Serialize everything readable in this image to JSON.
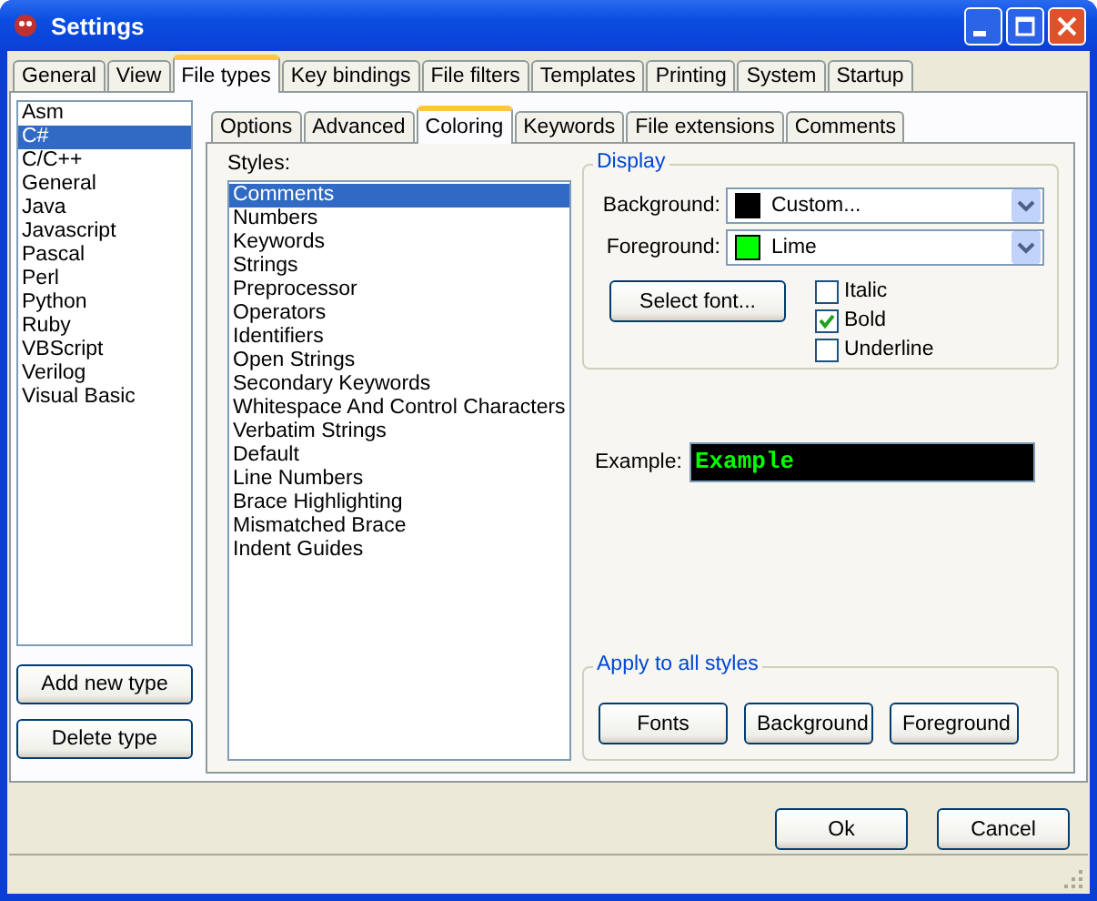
{
  "window": {
    "title": "Settings"
  },
  "tabs": [
    {
      "label": "General",
      "selected": false
    },
    {
      "label": "View",
      "selected": false
    },
    {
      "label": "File types",
      "selected": true
    },
    {
      "label": "Key bindings",
      "selected": false
    },
    {
      "label": "File filters",
      "selected": false
    },
    {
      "label": "Templates",
      "selected": false
    },
    {
      "label": "Printing",
      "selected": false
    },
    {
      "label": "System",
      "selected": false
    },
    {
      "label": "Startup",
      "selected": false
    }
  ],
  "file_types": {
    "items": [
      {
        "label": "Asm",
        "selected": false
      },
      {
        "label": "C#",
        "selected": true
      },
      {
        "label": "C/C++",
        "selected": false
      },
      {
        "label": "General",
        "selected": false
      },
      {
        "label": "Java",
        "selected": false
      },
      {
        "label": "Javascript",
        "selected": false
      },
      {
        "label": "Pascal",
        "selected": false
      },
      {
        "label": "Perl",
        "selected": false
      },
      {
        "label": "Python",
        "selected": false
      },
      {
        "label": "Ruby",
        "selected": false
      },
      {
        "label": "VBScript",
        "selected": false
      },
      {
        "label": "Verilog",
        "selected": false
      },
      {
        "label": "Visual Basic",
        "selected": false
      }
    ],
    "buttons": [
      "Add new type",
      "Delete type"
    ]
  },
  "sub_tabs": [
    {
      "label": "Options",
      "selected": false
    },
    {
      "label": "Advanced",
      "selected": false
    },
    {
      "label": "Coloring",
      "selected": true
    },
    {
      "label": "Keywords",
      "selected": false
    },
    {
      "label": "File extensions",
      "selected": false
    },
    {
      "label": "Comments",
      "selected": false
    }
  ],
  "styles": {
    "label": "Styles:",
    "items": [
      {
        "label": "Comments",
        "selected": true
      },
      {
        "label": "Numbers",
        "selected": false
      },
      {
        "label": "Keywords",
        "selected": false
      },
      {
        "label": "Strings",
        "selected": false
      },
      {
        "label": "Preprocessor",
        "selected": false
      },
      {
        "label": "Operators",
        "selected": false
      },
      {
        "label": "Identifiers",
        "selected": false
      },
      {
        "label": "Open Strings",
        "selected": false
      },
      {
        "label": "Secondary Keywords",
        "selected": false
      },
      {
        "label": "Whitespace And Control Characters",
        "selected": false
      },
      {
        "label": "Verbatim Strings",
        "selected": false
      },
      {
        "label": "Default",
        "selected": false
      },
      {
        "label": "Line Numbers",
        "selected": false
      },
      {
        "label": "Brace Highlighting",
        "selected": false
      },
      {
        "label": "Mismatched Brace",
        "selected": false
      },
      {
        "label": "Indent Guides",
        "selected": false
      }
    ]
  },
  "display": {
    "title": "Display",
    "colors": [
      {
        "label": "Background:",
        "value": "Custom...",
        "color": "#000000"
      },
      {
        "label": "Foreground:",
        "value": "Lime",
        "color": "#00ff00"
      }
    ],
    "select_font": "Select font...",
    "options": [
      {
        "label": "Italic",
        "checked": false
      },
      {
        "label": "Bold",
        "checked": true
      },
      {
        "label": "Underline",
        "checked": false
      }
    ]
  },
  "example": {
    "label": "Example:",
    "text": "Example"
  },
  "apply": {
    "title": "Apply to all styles",
    "buttons": [
      "Fonts",
      "Background",
      "Foreground"
    ]
  },
  "buttons": [
    "Ok",
    "Cancel"
  ]
}
